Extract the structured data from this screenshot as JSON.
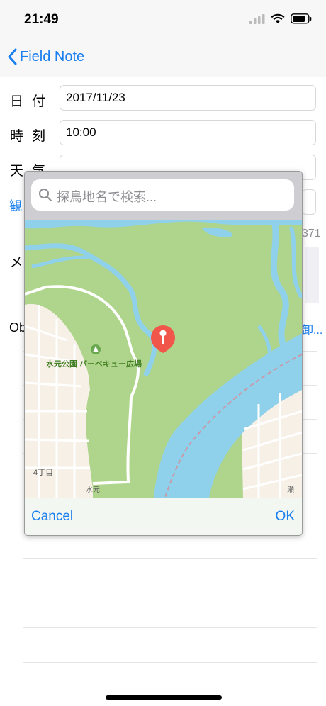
{
  "status_bar": {
    "time": "21:49"
  },
  "nav": {
    "back_label": "Field Note"
  },
  "form": {
    "date_label": "日付",
    "date_value": "2017/11/23",
    "time_label": "時刻",
    "time_value": "10:00",
    "weather_label": "天気",
    "weather_value": ""
  },
  "background_partial": {
    "observe_link": "観",
    "number_text": "371",
    "memo_label": "メ",
    "ob_label": "Ob",
    "right_link": "卸..."
  },
  "map_dialog": {
    "search_placeholder": "探鳥地名で検索...",
    "poi_label": "水元公園 バーベキュー広場",
    "area_label": "4丁目",
    "road_label_1": "水元",
    "road_label_2": "瀬",
    "cancel_label": "Cancel",
    "ok_label": "OK",
    "colors": {
      "park": "#aed58b",
      "water": "#8fd0eb",
      "land": "#f6f0e6",
      "road": "#ffffff",
      "pin": "#f0564a",
      "accent": "#1a7ff0"
    }
  }
}
